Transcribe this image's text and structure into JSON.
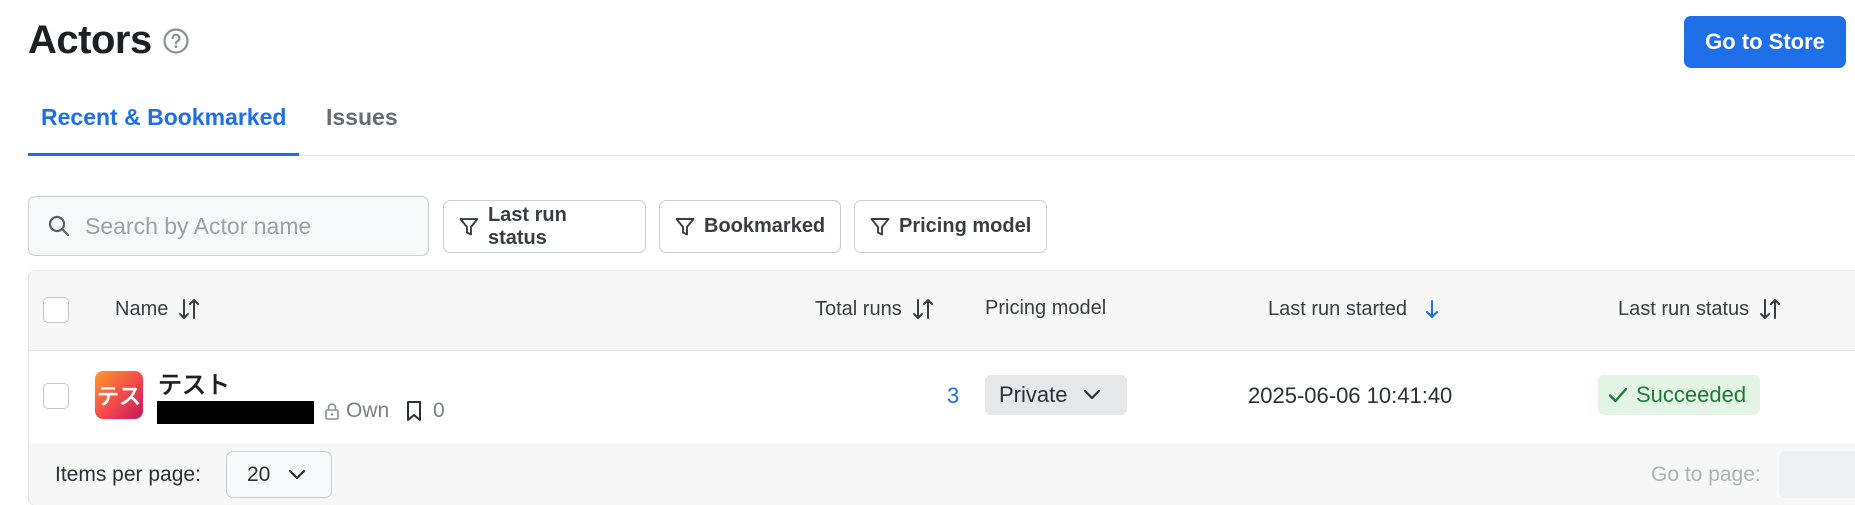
{
  "header": {
    "title": "Actors",
    "help_icon": "question-circle-icon",
    "store_button": "Go to Store"
  },
  "tabs": [
    {
      "label": "Recent & Bookmarked",
      "active": true
    },
    {
      "label": "Issues",
      "active": false
    }
  ],
  "toolbar": {
    "search_placeholder": "Search by Actor name",
    "filters": [
      "Last run status",
      "Bookmarked",
      "Pricing model"
    ]
  },
  "table": {
    "columns": {
      "name": "Name",
      "total_runs": "Total runs",
      "pricing_model": "Pricing model",
      "last_run_started": "Last run started",
      "last_run_status": "Last run status"
    },
    "rows": [
      {
        "avatar_text": "テス",
        "name": "テスト",
        "owner_tag": "Own",
        "bookmark_count": "0",
        "total_runs": "3",
        "pricing_model": "Private",
        "last_run_started": "2025-06-06 10:41:40",
        "last_run_status": "Succeeded"
      }
    ]
  },
  "pagination": {
    "items_per_page_label": "Items per page:",
    "items_per_page_value": "20",
    "go_to_page_label": "Go to page:"
  },
  "colors": {
    "accent": "#1e6fe8",
    "success_bg": "#e3f4e6",
    "success_text": "#1e7a34"
  }
}
